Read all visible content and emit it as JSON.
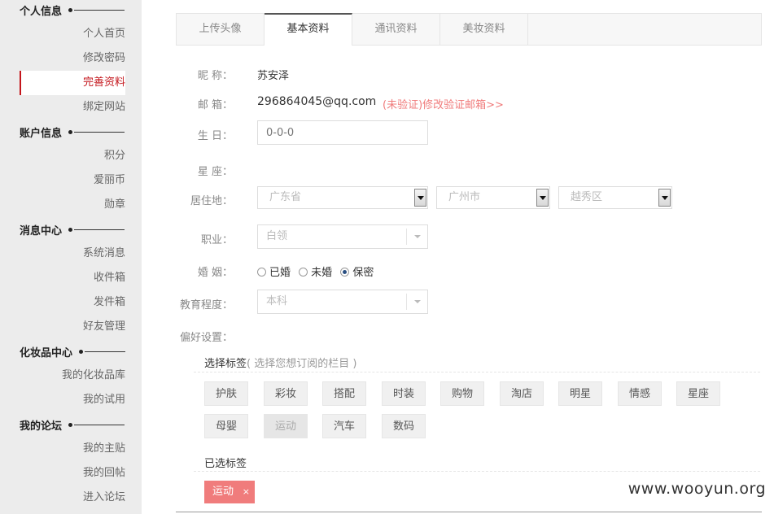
{
  "sidebar": {
    "sections": [
      {
        "title": "个人信息",
        "items": [
          "个人首页",
          "修改密码",
          "完善资料",
          "绑定网站"
        ]
      },
      {
        "title": "账户信息",
        "items": [
          "积分",
          "爱丽币",
          "勋章"
        ]
      },
      {
        "title": "消息中心",
        "items": [
          "系统消息",
          "收件箱",
          "发件箱",
          "好友管理"
        ]
      },
      {
        "title": "化妆品中心",
        "items": [
          "我的化妆品库",
          "我的试用"
        ]
      },
      {
        "title": "我的论坛",
        "items": [
          "我的主贴",
          "我的回帖",
          "进入论坛"
        ]
      }
    ],
    "active": "完善资料"
  },
  "tabs": [
    "上传头像",
    "基本资料",
    "通讯资料",
    "美妆资料"
  ],
  "active_tab": "基本资料",
  "form": {
    "nickname_label": "昵 称：",
    "nickname": "苏安泽",
    "email_label": "邮 箱：",
    "email": "296864045@qq.com",
    "email_note": "(未验证)修改验证邮箱>>",
    "birthday_label": "生 日：",
    "birthday_placeholder": "0-0-0",
    "constellation_label": "星 座：",
    "residence_label": "居住地：",
    "province": "广东省",
    "city": "广州市",
    "district": "越秀区",
    "job_label": "职业：",
    "job": "白领",
    "marriage_label": "婚 姻：",
    "marriage_options": [
      "已婚",
      "未婚",
      "保密"
    ],
    "marriage_selected": "保密",
    "education_label": "教育程度：",
    "education": "本科",
    "preference_label": "偏好设置："
  },
  "tags": {
    "title": "选择标签",
    "hint": "( 选择您想订阅的栏目 )",
    "list": [
      "护肤",
      "彩妆",
      "搭配",
      "时装",
      "购物",
      "淘店",
      "明星",
      "情感",
      "星座",
      "母婴",
      "运动",
      "汽车",
      "数码"
    ],
    "selected_title": "已选标签",
    "selected": [
      "运动"
    ],
    "remove_label": "×"
  },
  "watermark": "www.wooyun.org",
  "colors": {
    "accent": "#c4161c",
    "email_note": "#f07c7c",
    "selected_tag": "#f07c7c"
  }
}
